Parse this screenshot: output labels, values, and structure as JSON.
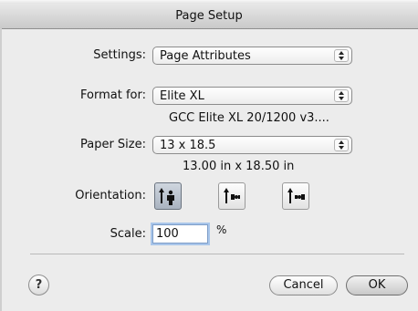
{
  "window": {
    "title": "Page Setup"
  },
  "settings": {
    "label": "Settings:",
    "value": "Page Attributes"
  },
  "format_for": {
    "label": "Format for:",
    "value": "Elite XL",
    "printer_info": "GCC Elite XL 20/1200 v3...."
  },
  "paper_size": {
    "label": "Paper Size:",
    "value": "13 x 18.5",
    "dimensions": "13.00 in x 18.50 in"
  },
  "orientation": {
    "label": "Orientation:",
    "options": [
      {
        "name": "portrait",
        "selected": true
      },
      {
        "name": "landscape-left",
        "selected": false
      },
      {
        "name": "landscape-right",
        "selected": false
      }
    ]
  },
  "scale": {
    "label": "Scale:",
    "value": "100",
    "unit": "%"
  },
  "buttons": {
    "help": "?",
    "cancel": "Cancel",
    "ok": "OK"
  },
  "colors": {
    "focus_ring": "#a9c6ea",
    "selected_segment": "#a9b3c0"
  }
}
